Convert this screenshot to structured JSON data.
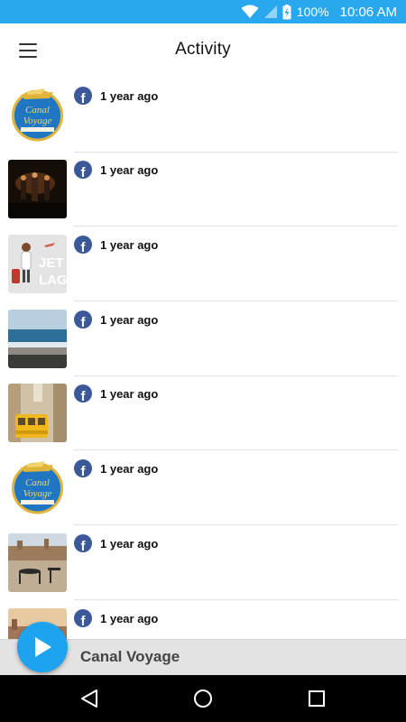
{
  "status_bar": {
    "battery": "100%",
    "time": "10:06 AM",
    "icons": [
      "wifi-icon",
      "signal-icon",
      "battery-charging-icon"
    ],
    "color": "#29a8f0"
  },
  "header": {
    "title": "Activity",
    "menu_icon": "hamburger-menu-icon"
  },
  "feed": {
    "source_icon": "facebook-icon",
    "items": [
      {
        "thumbnail": "canal-voyage-logo",
        "time": "1 year ago"
      },
      {
        "thumbnail": "concert-stage-photo",
        "time": "1 year ago"
      },
      {
        "thumbnail": "jet-lag-illustration",
        "time": "1 year ago"
      },
      {
        "thumbnail": "sea-beach-photo",
        "time": "1 year ago"
      },
      {
        "thumbnail": "yellow-tram-photo",
        "time": "1 year ago"
      },
      {
        "thumbnail": "canal-voyage-logo",
        "time": "1 year ago"
      },
      {
        "thumbnail": "terrace-city-photo",
        "time": "1 year ago"
      },
      {
        "thumbnail": "sunset-city-photo",
        "time": "1 year ago"
      }
    ]
  },
  "player": {
    "title": "Canal Voyage",
    "play_icon": "play-icon",
    "accent": "#1ea3ee"
  },
  "nav_bar": {
    "buttons": [
      "back-icon",
      "home-icon",
      "recents-icon"
    ]
  }
}
